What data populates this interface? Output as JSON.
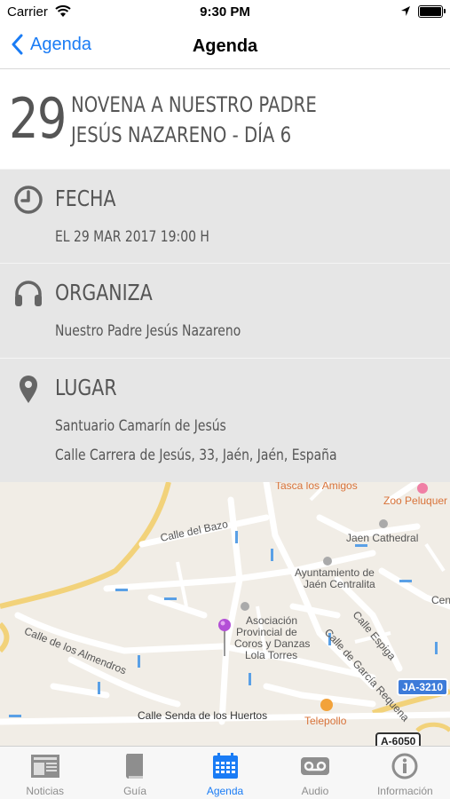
{
  "status_bar": {
    "carrier": "Carrier",
    "time": "9:30 PM"
  },
  "nav": {
    "back_label": "Agenda",
    "title": "Agenda"
  },
  "event": {
    "day": "29",
    "title_line1": "NOVENA A NUESTRO PADRE",
    "title_line2": "JESÚS NAZARENO - DÍA 6"
  },
  "fecha": {
    "heading": "FECHA",
    "value": "EL 29 MAR 2017 19:00 H"
  },
  "organiza": {
    "heading": "ORGANIZA",
    "value": "Nuestro Padre Jesús Nazareno"
  },
  "lugar": {
    "heading": "LUGAR",
    "place": "Santuario Camarín de Jesús",
    "address": "Calle Carrera de Jesús, 33, Jaén, Jaén, España"
  },
  "map": {
    "labels": {
      "tasca": "Tasca los Amigos",
      "zoo": "Zoo Peluquer",
      "cathedral": "Jaen Cathedral",
      "calle_bazo": "Calle del Bazo",
      "ayuntamiento_1": "Ayuntamiento de",
      "ayuntamiento_2": "Jaén Centralita",
      "almendros": "Calle de los Almendros",
      "asociacion_1": "Asociación",
      "asociacion_2": "Provincial de",
      "asociacion_3": "Coros y Danzas",
      "asociacion_4": "Lola Torres",
      "garcia": "Calle de García Requena",
      "espiga": "Calle Espiga",
      "cen": "Cen",
      "senda": "Calle Senda de los Huertos",
      "telepollo": "Telepollo",
      "ja3210": "JA-3210",
      "a6050": "A-6050"
    },
    "pin_color": "#b34fd6"
  },
  "tabs": [
    {
      "label": "Noticias",
      "icon": "newspaper-icon"
    },
    {
      "label": "Guía",
      "icon": "book-icon"
    },
    {
      "label": "Agenda",
      "icon": "calendar-icon"
    },
    {
      "label": "Audio",
      "icon": "voicemail-icon"
    },
    {
      "label": "Información",
      "icon": "info-icon"
    }
  ],
  "colors": {
    "accent": "#1a7cf5",
    "panel": "#e6e6e6",
    "text": "#555555"
  }
}
